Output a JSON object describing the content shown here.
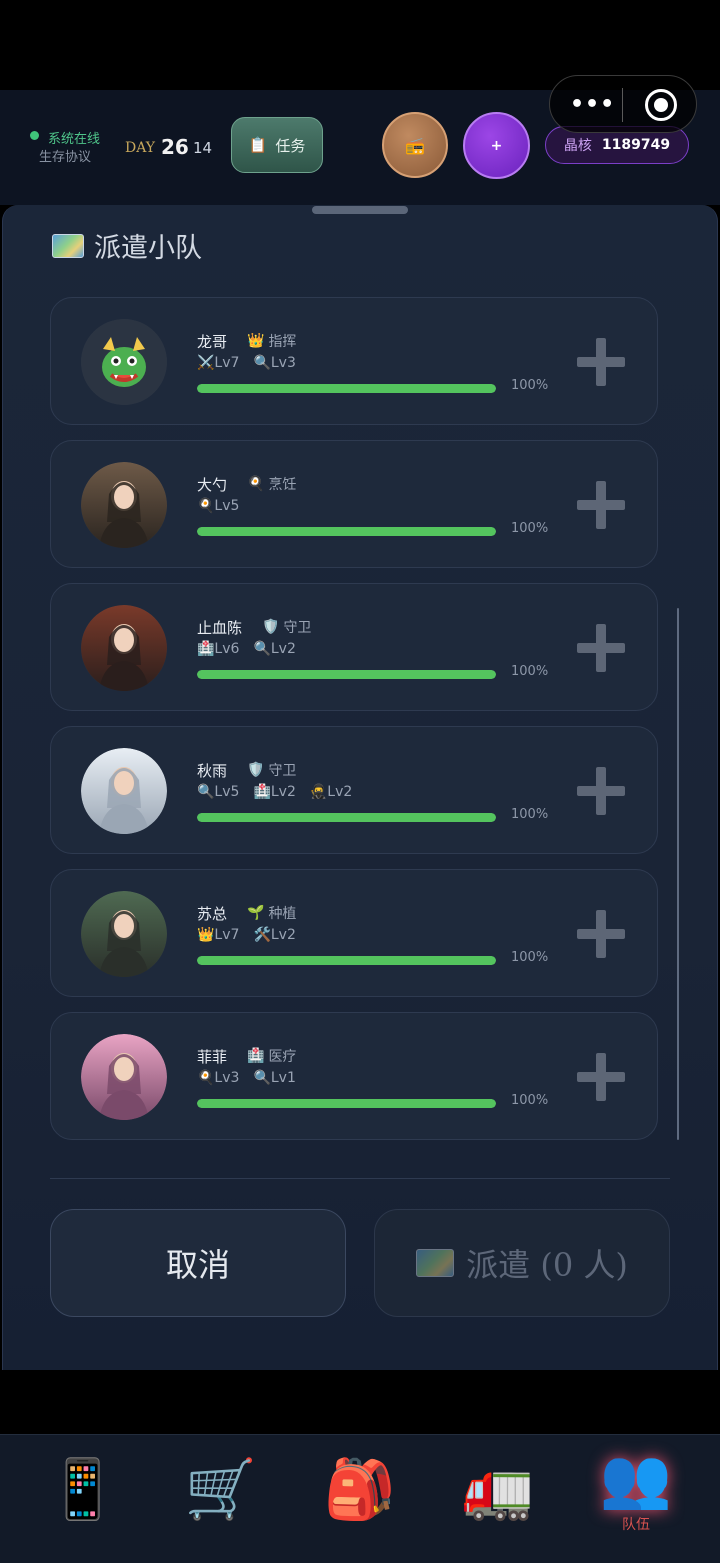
{
  "header": {
    "status_online": "系统在线",
    "status_protocol": "生存协议",
    "day_label": "DAY",
    "day_number": "26",
    "day_sub": "14",
    "task_icon": "📋",
    "task_label": "任务",
    "radio_icon": "📻",
    "plus_label": "+",
    "crystal_label": "晶核",
    "crystal_value": "1189749",
    "capsule_menu_icon": "more-dots-icon",
    "capsule_close_icon": "target-icon"
  },
  "sheet": {
    "title": "派遣小队",
    "title_icon": "map-icon"
  },
  "members": [
    {
      "name": "龙哥",
      "role_icon": "👑",
      "role": "指挥",
      "skills": [
        "⚔️Lv7",
        "🔍Lv3"
      ],
      "progress": 100,
      "progress_label": "100%",
      "avatar": "dragon"
    },
    {
      "name": "大勺",
      "role_icon": "🍳",
      "role": "烹饪",
      "skills": [
        "🍳Lv5"
      ],
      "progress": 100,
      "progress_label": "100%",
      "avatar": "portrait"
    },
    {
      "name": "止血陈",
      "role_icon": "🛡️",
      "role": "守卫",
      "skills": [
        "🏥Lv6",
        "🔍Lv2"
      ],
      "progress": 100,
      "progress_label": "100%",
      "avatar": "portrait"
    },
    {
      "name": "秋雨",
      "role_icon": "🛡️",
      "role": "守卫",
      "skills": [
        "🔍Lv5",
        "🏥Lv2",
        "🥷Lv2"
      ],
      "progress": 100,
      "progress_label": "100%",
      "avatar": "portrait"
    },
    {
      "name": "苏总",
      "role_icon": "🌱",
      "role": "种植",
      "skills": [
        "👑Lv7",
        "🛠️Lv2"
      ],
      "progress": 100,
      "progress_label": "100%",
      "avatar": "portrait"
    },
    {
      "name": "菲菲",
      "role_icon": "🏥",
      "role": "医疗",
      "skills": [
        "🍳Lv3",
        "🔍Lv1"
      ],
      "progress": 100,
      "progress_label": "100%",
      "avatar": "portrait"
    }
  ],
  "actions": {
    "cancel_label": "取消",
    "dispatch_label": "派遣 (0 人)"
  },
  "nav": {
    "items": [
      {
        "glyph": "📱",
        "label": ""
      },
      {
        "glyph": "🛒",
        "label": ""
      },
      {
        "glyph": "🎒",
        "label": ""
      },
      {
        "glyph": "🚛",
        "label": ""
      },
      {
        "glyph": "👥",
        "label": "队伍"
      }
    ]
  },
  "colors": {
    "progress": "#54c45e",
    "accent_purple": "#7b3fc8",
    "online_green": "#3fc47a"
  }
}
